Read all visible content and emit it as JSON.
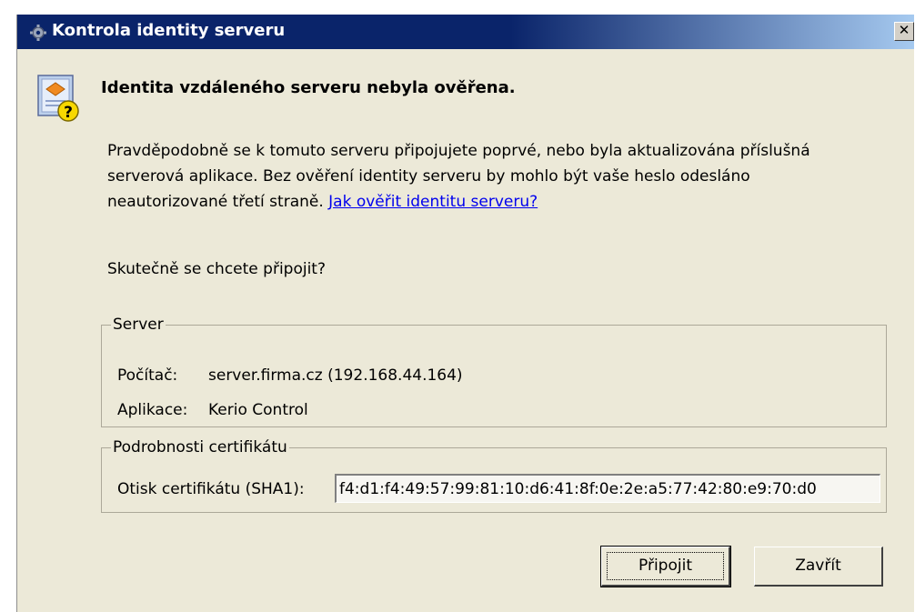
{
  "window": {
    "title": "Kontrola identity serveru",
    "close_glyph": "✕"
  },
  "heading": "Identita vzdáleného serveru nebyla ověřena.",
  "message": {
    "line1": "Pravděpodobně se k tomuto serveru připojujete poprvé, nebo byla aktualizována příslušná",
    "line2": "serverová aplikace. Bez ověření identity serveru by mohlo být vaše heslo odesláno",
    "line3": "neautorizované třetí straně.",
    "link": "Jak ověřit identitu serveru?"
  },
  "question": "Skutečně se chcete připojit?",
  "server": {
    "legend": "Server",
    "computer_label": "Počítač:",
    "computer_value": "server.firma.cz (192.168.44.164)",
    "app_label": "Aplikace:",
    "app_value": "Kerio Control"
  },
  "cert": {
    "legend": "Podrobnosti certifikátu",
    "fp_label": "Otisk certifikátu (SHA1):",
    "fp_value": "f4:d1:f4:49:57:99:81:10:d6:41:8f:0e:2e:a5:77:42:80:e9:70:d0"
  },
  "buttons": {
    "connect": "Připojit",
    "close": "Zavřít"
  },
  "colors": {
    "titlebar_dark": "#0a246a",
    "titlebar_light": "#a6caf0",
    "dialog_bg": "#ece9d8",
    "link": "#0000ee"
  },
  "icons": {
    "title": "gear-icon",
    "main": "certificate-question-icon"
  }
}
